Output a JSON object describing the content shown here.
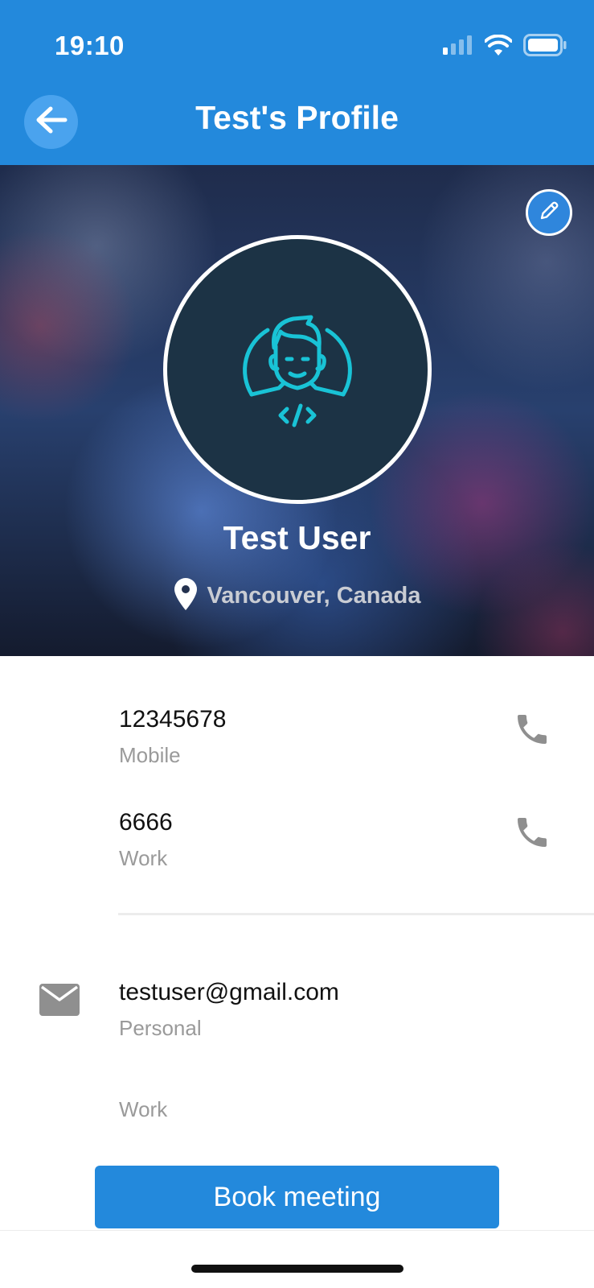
{
  "status_bar": {
    "time": "19:10",
    "icons": [
      "cellular-signal-icon",
      "wifi-icon",
      "battery-icon"
    ]
  },
  "header": {
    "title": "Test's Profile",
    "back_icon": "arrow-left-icon",
    "background_color": "#2389dc"
  },
  "profile": {
    "name": "Test User",
    "location": "Vancouver, Canada",
    "location_icon": "map-pin-icon",
    "avatar_icon": "developer-avatar-icon",
    "edit_icon": "pencil-icon"
  },
  "contacts": {
    "phones": [
      {
        "number": "12345678",
        "type": "Mobile",
        "action_icon": "phone-icon"
      },
      {
        "number": "6666",
        "type": "Work",
        "action_icon": "phone-icon"
      }
    ],
    "emails": [
      {
        "address": "testuser@gmail.com",
        "type": "Personal",
        "icon": "mail-icon"
      },
      {
        "address": "",
        "type": "Work"
      }
    ]
  },
  "actions": {
    "book_meeting_label": "Book meeting"
  },
  "colors": {
    "accent": "#2389dc",
    "label_gray": "#9a9a9a",
    "icon_gray": "#8f8f8f",
    "avatar_line": "#19c3d6"
  }
}
